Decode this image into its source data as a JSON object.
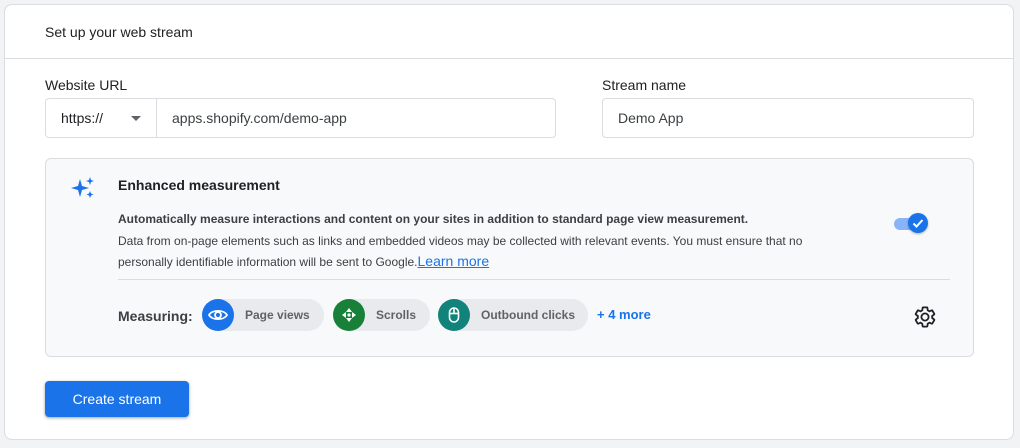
{
  "header": {
    "title": "Set up your web stream"
  },
  "form": {
    "website_url_label": "Website URL",
    "protocol": "https://",
    "url_value": "apps.shopify.com/demo-app",
    "stream_name_label": "Stream name",
    "stream_name_value": "Demo App"
  },
  "enhanced_measurement": {
    "icon": "sparkle-icon",
    "title": "Enhanced measurement",
    "description_bold": "Automatically measure interactions and content on your sites in addition to standard page view measurement.",
    "description": "Data from on-page elements such as links and embedded videos may be collected with relevant events. You must ensure that no personally identifiable information will be sent to Google.",
    "learn_more": "Learn more",
    "toggle_on": true,
    "measuring_label": "Measuring:",
    "chips": [
      {
        "label": "Page views",
        "icon": "eye-icon",
        "color": "#1a73e8"
      },
      {
        "label": "Scrolls",
        "icon": "scroll-arrows-icon",
        "color": "#188038"
      },
      {
        "label": "Outbound clicks",
        "icon": "mouse-icon",
        "color": "#12837a"
      }
    ],
    "more_label": "+ 4 more",
    "settings_icon": "gear-icon"
  },
  "actions": {
    "create_label": "Create stream"
  },
  "colors": {
    "primary": "#1a73e8",
    "border": "#dadce0",
    "panel": "#f8f9fa"
  }
}
